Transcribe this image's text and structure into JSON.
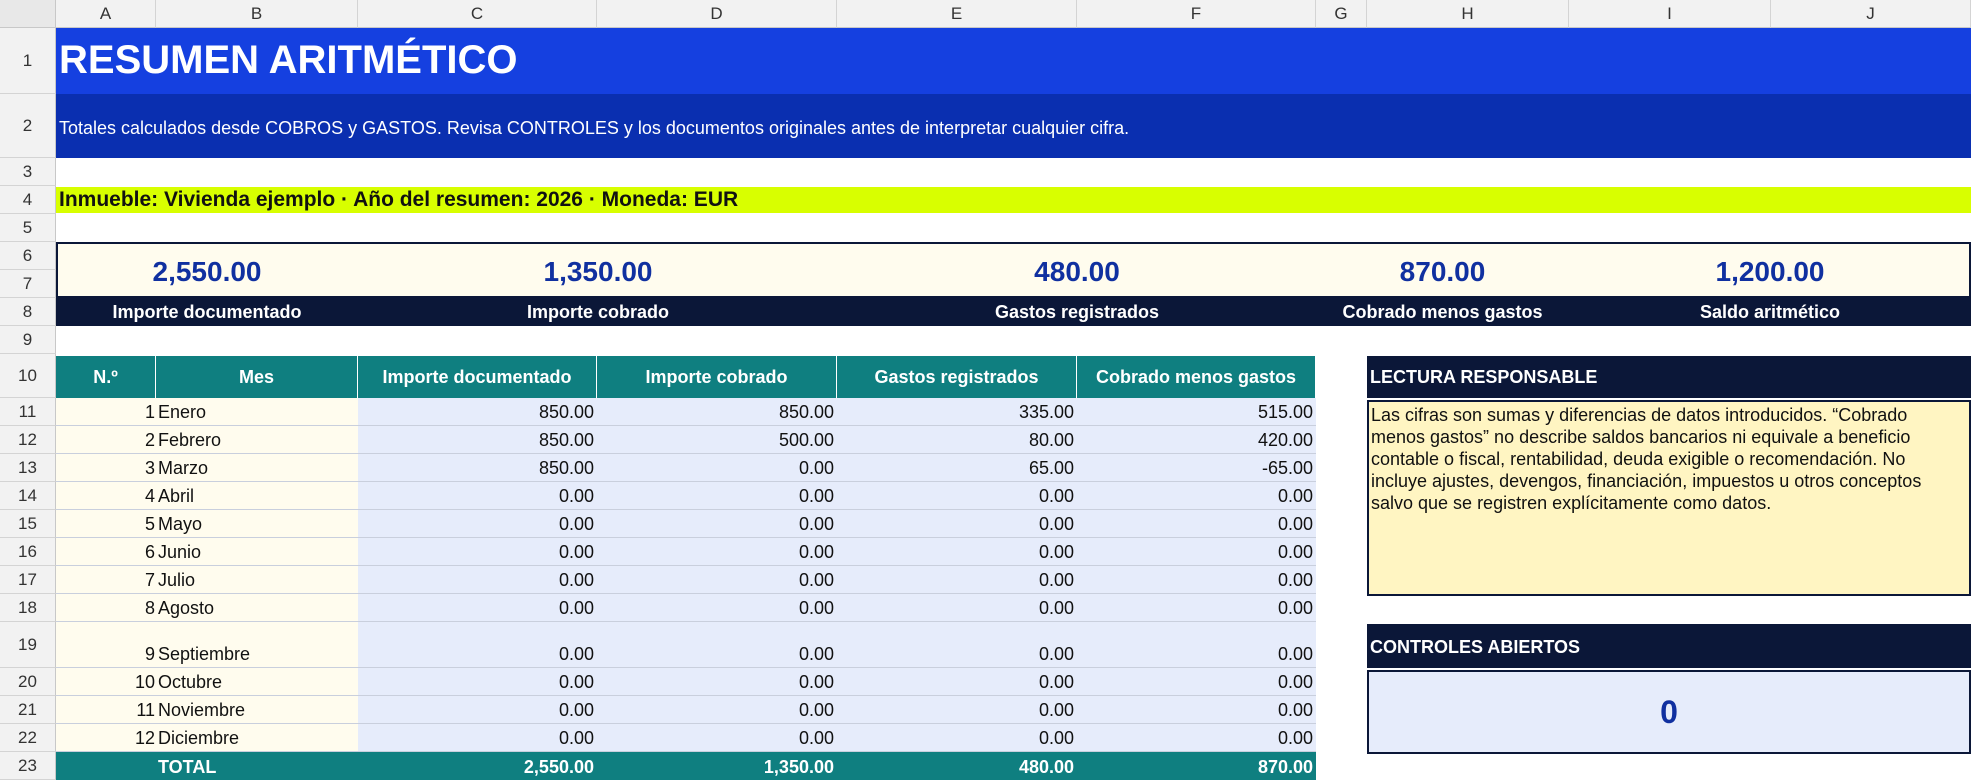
{
  "columns": [
    "A",
    "B",
    "C",
    "D",
    "E",
    "F",
    "G",
    "H",
    "I",
    "J"
  ],
  "rows": [
    "1",
    "2",
    "3",
    "4",
    "5",
    "6",
    "7",
    "8",
    "9",
    "10",
    "11",
    "12",
    "13",
    "14",
    "15",
    "16",
    "17",
    "18",
    "19",
    "20",
    "21",
    "22",
    "23"
  ],
  "title": "RESUMEN ARITMÉTICO",
  "subtitle": "Totales calculados desde COBROS y GASTOS. Revisa CONTROLES y los documentos originales antes de interpretar cualquier cifra.",
  "info_line": "Inmueble: Vivienda ejemplo · Año del resumen: 2026 · Moneda: EUR",
  "kpis": [
    {
      "value": "2,550.00",
      "label": "Importe documentado"
    },
    {
      "value": "1,350.00",
      "label": "Importe cobrado"
    },
    {
      "value": "480.00",
      "label": "Gastos registrados"
    },
    {
      "value": "870.00",
      "label": "Cobrado menos gastos"
    },
    {
      "value": "1,200.00",
      "label": "Saldo aritmético"
    }
  ],
  "table": {
    "headers": [
      "N.º",
      "Mes",
      "Importe documentado",
      "Importe cobrado",
      "Gastos registrados",
      "Cobrado menos gastos"
    ],
    "rows": [
      [
        "1",
        "Enero",
        "850.00",
        "850.00",
        "335.00",
        "515.00"
      ],
      [
        "2",
        "Febrero",
        "850.00",
        "500.00",
        "80.00",
        "420.00"
      ],
      [
        "3",
        "Marzo",
        "850.00",
        "0.00",
        "65.00",
        "-65.00"
      ],
      [
        "4",
        "Abril",
        "0.00",
        "0.00",
        "0.00",
        "0.00"
      ],
      [
        "5",
        "Mayo",
        "0.00",
        "0.00",
        "0.00",
        "0.00"
      ],
      [
        "6",
        "Junio",
        "0.00",
        "0.00",
        "0.00",
        "0.00"
      ],
      [
        "7",
        "Julio",
        "0.00",
        "0.00",
        "0.00",
        "0.00"
      ],
      [
        "8",
        "Agosto",
        "0.00",
        "0.00",
        "0.00",
        "0.00"
      ],
      [
        "9",
        "Septiembre",
        "0.00",
        "0.00",
        "0.00",
        "0.00"
      ],
      [
        "10",
        "Octubre",
        "0.00",
        "0.00",
        "0.00",
        "0.00"
      ],
      [
        "11",
        "Noviembre",
        "0.00",
        "0.00",
        "0.00",
        "0.00"
      ],
      [
        "12",
        "Diciembre",
        "0.00",
        "0.00",
        "0.00",
        "0.00"
      ]
    ],
    "total": {
      "label": "TOTAL",
      "values": [
        "2,550.00",
        "1,350.00",
        "480.00",
        "870.00"
      ]
    }
  },
  "lectura": {
    "title": "LECTURA RESPONSABLE",
    "text": "Las cifras son sumas y diferencias de datos introducidos. “Cobrado menos gastos” no describe saldos bancarios ni equivale a beneficio contable o fiscal, rentabilidad, deuda exigible o recomendación. No incluye ajustes, devengos, financiación, impuestos u otros conceptos salvo que se registren explícitamente como datos."
  },
  "controles": {
    "title": "CONTROLES ABIERTOS",
    "value": "0"
  },
  "colors": {
    "title_bg": "#1540e0",
    "subtitle_bg": "#0a2fb0",
    "info_bg": "#d8ff00",
    "navy": "#0b1738",
    "teal": "#0f7f80",
    "kpi_value": "#1030a0",
    "note_bg": "#fff5c2",
    "input_bg": "#e6ecfb",
    "cream": "#fffcee"
  }
}
